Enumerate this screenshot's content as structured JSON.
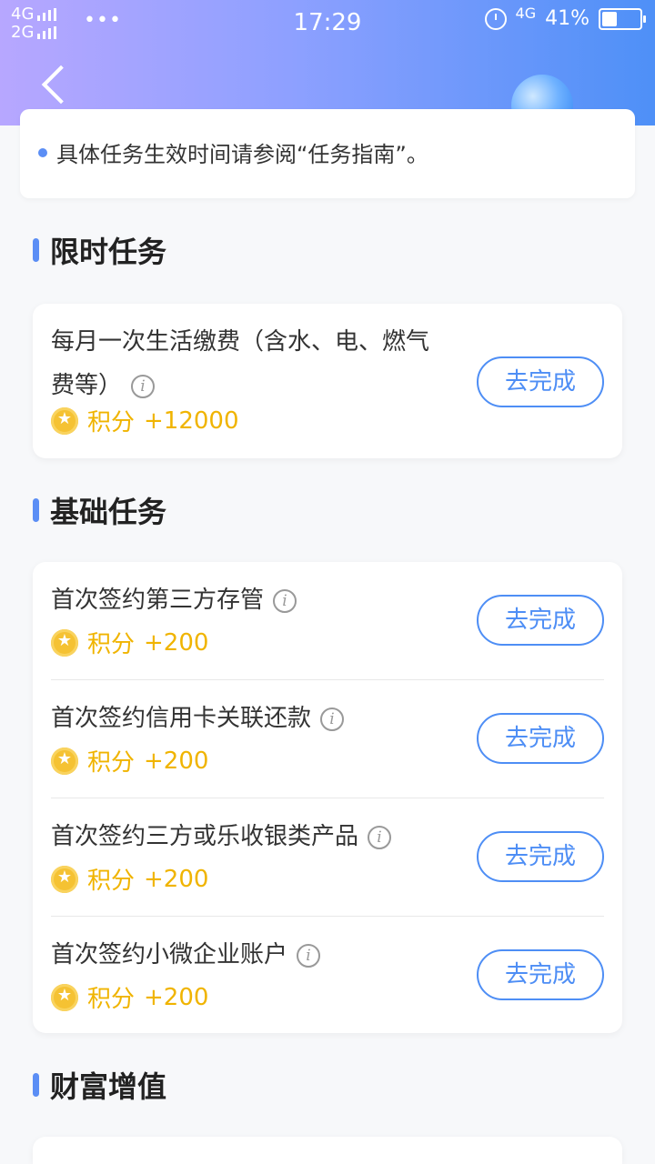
{
  "status_bar": {
    "signal_1": "4G",
    "signal_2": "2G",
    "dots": "•••",
    "time": "17:29",
    "net": "4G",
    "battery_text": "41%",
    "battery_level": 0.41
  },
  "notice": {
    "text": "具体任务生效时间请参阅“任务指南”。"
  },
  "sections": {
    "limited": {
      "title": "限时任务",
      "tasks": [
        {
          "name_line1": "每月一次生活缴费（含水、电、燃气",
          "name_line2": "费等）",
          "points_label": "积分",
          "points": "+12000",
          "button": "去完成"
        }
      ]
    },
    "basic": {
      "title": "基础任务",
      "tasks": [
        {
          "name": "首次签约第三方存管",
          "points_label": "积分",
          "points": "+200",
          "button": "去完成"
        },
        {
          "name": "首次签约信用卡关联还款",
          "points_label": "积分",
          "points": "+200",
          "button": "去完成"
        },
        {
          "name": "首次签约三方或乐收银类产品",
          "points_label": "积分",
          "points": "+200",
          "button": "去完成"
        },
        {
          "name": "首次签约小微企业账户",
          "points_label": "积分",
          "points": "+200",
          "button": "去完成"
        }
      ]
    },
    "wealth": {
      "title": "财富增值"
    }
  },
  "icons": {
    "info": "i",
    "coin": "coin-star-icon",
    "back": "chevron-left-icon"
  },
  "colors": {
    "accent": "#4e8ef5",
    "points": "#f0b400"
  }
}
